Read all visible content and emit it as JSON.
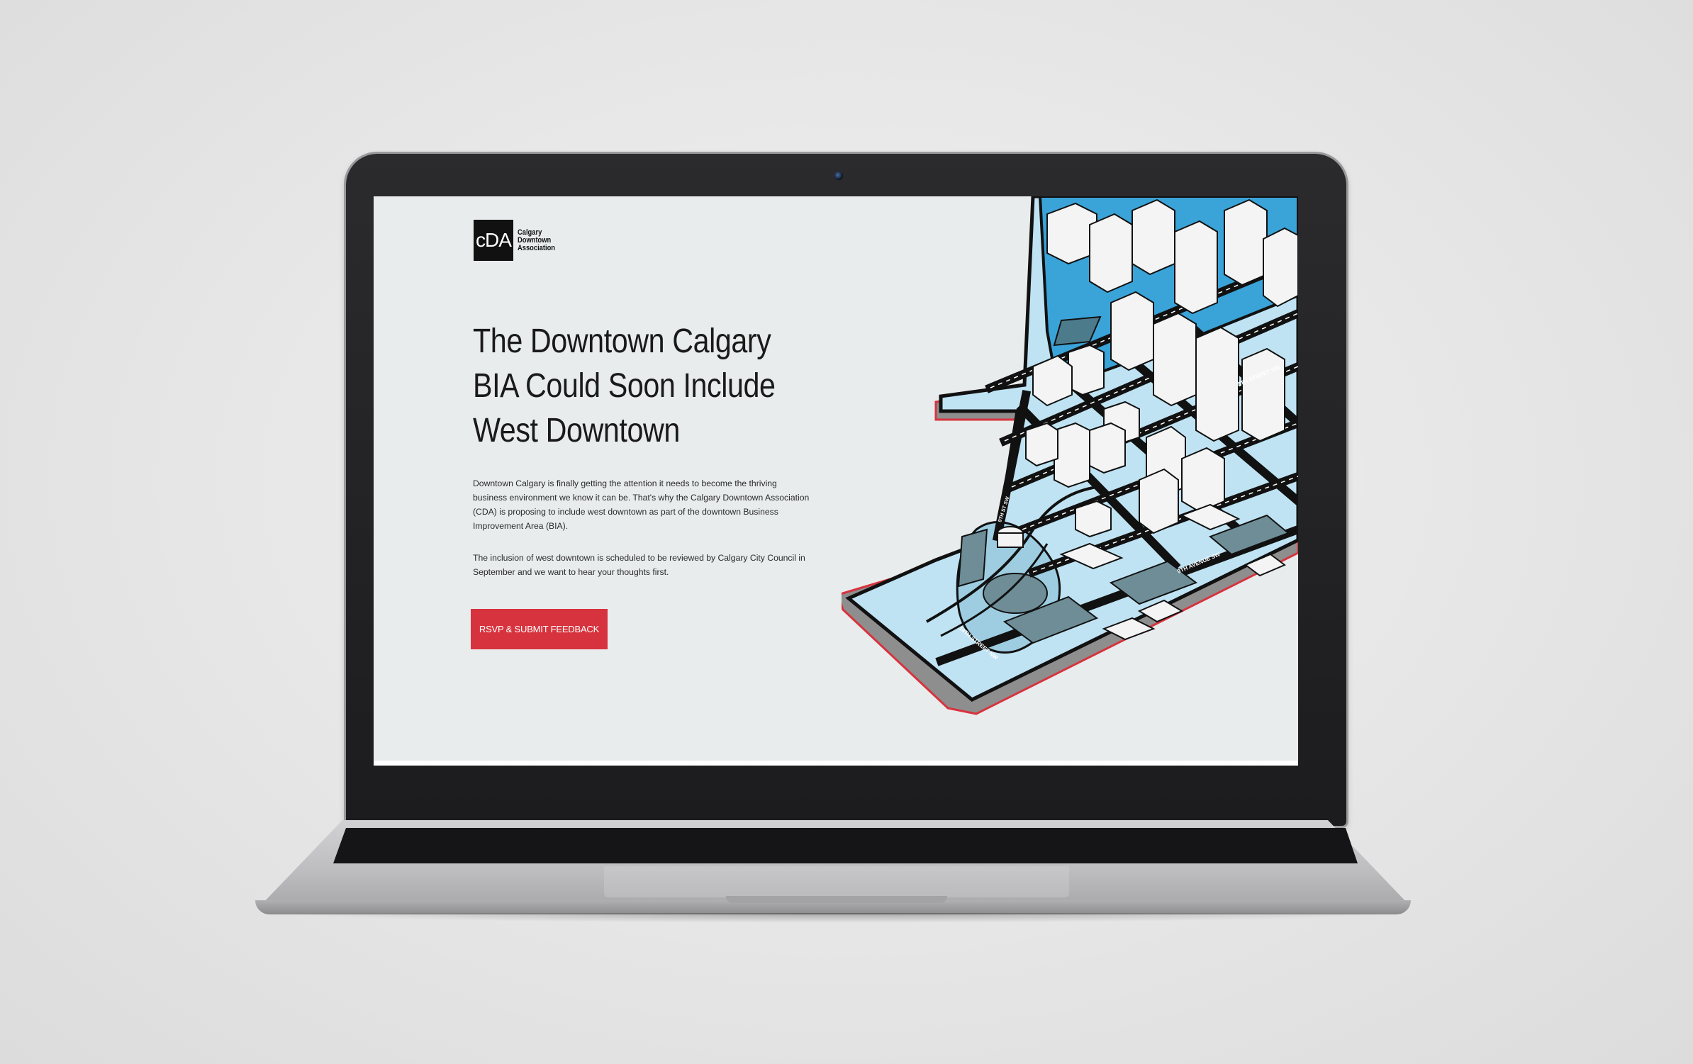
{
  "logo": {
    "mark": "cDA",
    "lines": [
      "Calgary",
      "Downtown",
      "Association"
    ]
  },
  "hero": {
    "headline_lines": [
      "The Downtown Calgary",
      "BIA Could Soon Include",
      "West Downtown"
    ],
    "paragraph1": "Downtown Calgary is finally getting the attention it needs to become the thriving business environment we know it can be. That's why the Calgary Downtown Association (CDA) is proposing to include west downtown as part of the downtown Business Improvement Area (BIA).",
    "paragraph2": "The inclusion of west downtown is scheduled to be reviewed by Calgary City Council in September and we want to hear your thoughts first.",
    "cta_label": "RSVP & SUBMIT FEEDBACK"
  },
  "map": {
    "street_labels": [
      "8TH STREET SW",
      "9TH AVENUE SW",
      "14TH STREET NW",
      "9TH ST SW"
    ]
  },
  "colors": {
    "accent": "#d7333e",
    "water": "#3aa3d8",
    "ground": "#bfe3f3",
    "screen_bg": "#e9ecec"
  }
}
